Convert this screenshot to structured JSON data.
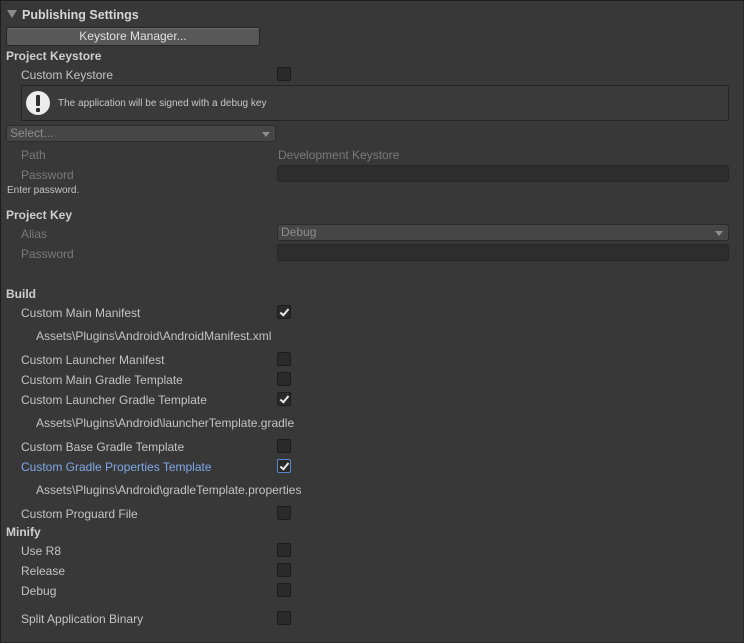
{
  "header": {
    "title": "Publishing Settings"
  },
  "keystore_manager_button": "Keystore Manager...",
  "project_keystore": {
    "heading": "Project Keystore",
    "custom_keystore_label": "Custom Keystore",
    "custom_keystore_checked": false,
    "help_message": "The application will be signed with a debug key",
    "help_icon": "warning-icon",
    "select_placeholder": "Select...",
    "path_label": "Path",
    "path_value": "Development Keystore",
    "password_label": "Password",
    "password_value": "",
    "hint": "Enter password."
  },
  "project_key": {
    "heading": "Project Key",
    "alias_label": "Alias",
    "alias_value": "Debug",
    "password_label": "Password",
    "password_value": ""
  },
  "build": {
    "heading": "Build",
    "items": [
      {
        "label": "Custom Main Manifest",
        "checked": true,
        "path": "Assets\\Plugins\\Android\\AndroidManifest.xml"
      },
      {
        "label": "Custom Launcher Manifest",
        "checked": false
      },
      {
        "label": "Custom Main Gradle Template",
        "checked": false
      },
      {
        "label": "Custom Launcher Gradle Template",
        "checked": true,
        "path": "Assets\\Plugins\\Android\\launcherTemplate.gradle"
      },
      {
        "label": "Custom Base Gradle Template",
        "checked": false
      },
      {
        "label": "Custom Gradle Properties Template",
        "checked": true,
        "path": "Assets\\Plugins\\Android\\gradleTemplate.properties"
      },
      {
        "label": "Custom Proguard File",
        "checked": false
      }
    ]
  },
  "minify": {
    "heading": "Minify",
    "items": [
      {
        "label": "Use R8",
        "checked": false
      },
      {
        "label": "Release",
        "checked": false
      },
      {
        "label": "Debug",
        "checked": false
      }
    ]
  },
  "split_binary": {
    "label": "Split Application Binary",
    "checked": false
  },
  "colors": {
    "background": "#383838",
    "text": "#c4c4c4",
    "focused_label": "#7fa8e8",
    "disabled_text": "#7a7a7a"
  }
}
